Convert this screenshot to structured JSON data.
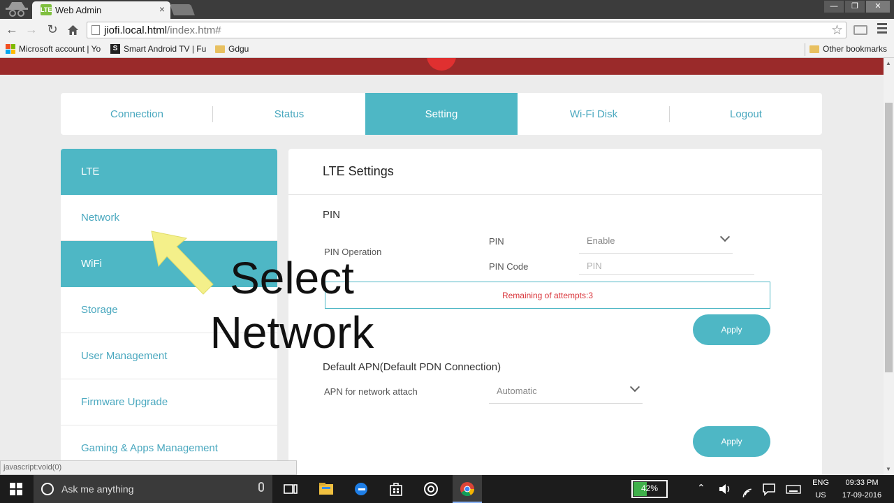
{
  "browser": {
    "tab_title": "Web Admin",
    "tab_favicon_text": "LTE",
    "tab_close": "×",
    "url_host": "jiofi.local.html",
    "url_path": "/index.htm#",
    "window_controls": {
      "minimize": "—",
      "restore": "❐",
      "close": "✕"
    },
    "bookmarks": [
      {
        "label": "Microsoft account | Yo",
        "icon": "microsoft-logo"
      },
      {
        "label": "Smart Android TV | Fu",
        "icon": "s-logo"
      },
      {
        "label": "Gdgu",
        "icon": "folder-icon"
      }
    ],
    "other_bookmarks": "Other bookmarks",
    "status_url": "javascript:void(0)"
  },
  "topnav": [
    {
      "label": "Connection",
      "active": false
    },
    {
      "label": "Status",
      "active": false
    },
    {
      "label": "Setting",
      "active": true
    },
    {
      "label": "Wi-Fi Disk",
      "active": false
    },
    {
      "label": "Logout",
      "active": false
    }
  ],
  "sidebar": [
    {
      "label": "LTE",
      "active": true
    },
    {
      "label": "Network",
      "active": false
    },
    {
      "label": "WiFi",
      "active": true
    },
    {
      "label": "Storage",
      "active": false
    },
    {
      "label": "User Management",
      "active": false
    },
    {
      "label": "Firmware Upgrade",
      "active": false
    },
    {
      "label": "Gaming & Apps Management",
      "active": false
    }
  ],
  "content": {
    "title": "LTE Settings",
    "pin_section": "PIN",
    "pin_operation_label": "PIN Operation",
    "pin_label": "PIN",
    "pin_value": "Enable",
    "pin_code_label": "PIN Code",
    "pin_code_placeholder": "PIN",
    "attempts_text": "Remaining of attempts:3",
    "apply_label": "Apply",
    "apn_section": "Default APN(Default PDN Connection)",
    "apn_label": "APN for network attach",
    "apn_value": "Automatic"
  },
  "overlay": {
    "line1": "Select",
    "line2": "Network",
    "arrow_color": "#f4f08a"
  },
  "taskbar": {
    "search_placeholder": "Ask me anything",
    "battery_percent": 42,
    "battery_text": "42%",
    "language": "ENG",
    "region": "US",
    "time": "09:33 PM",
    "date": "17-09-2016"
  },
  "colors": {
    "accent": "#4eb7c5",
    "header_red": "#9a2a2a",
    "error": "#d9343a"
  }
}
